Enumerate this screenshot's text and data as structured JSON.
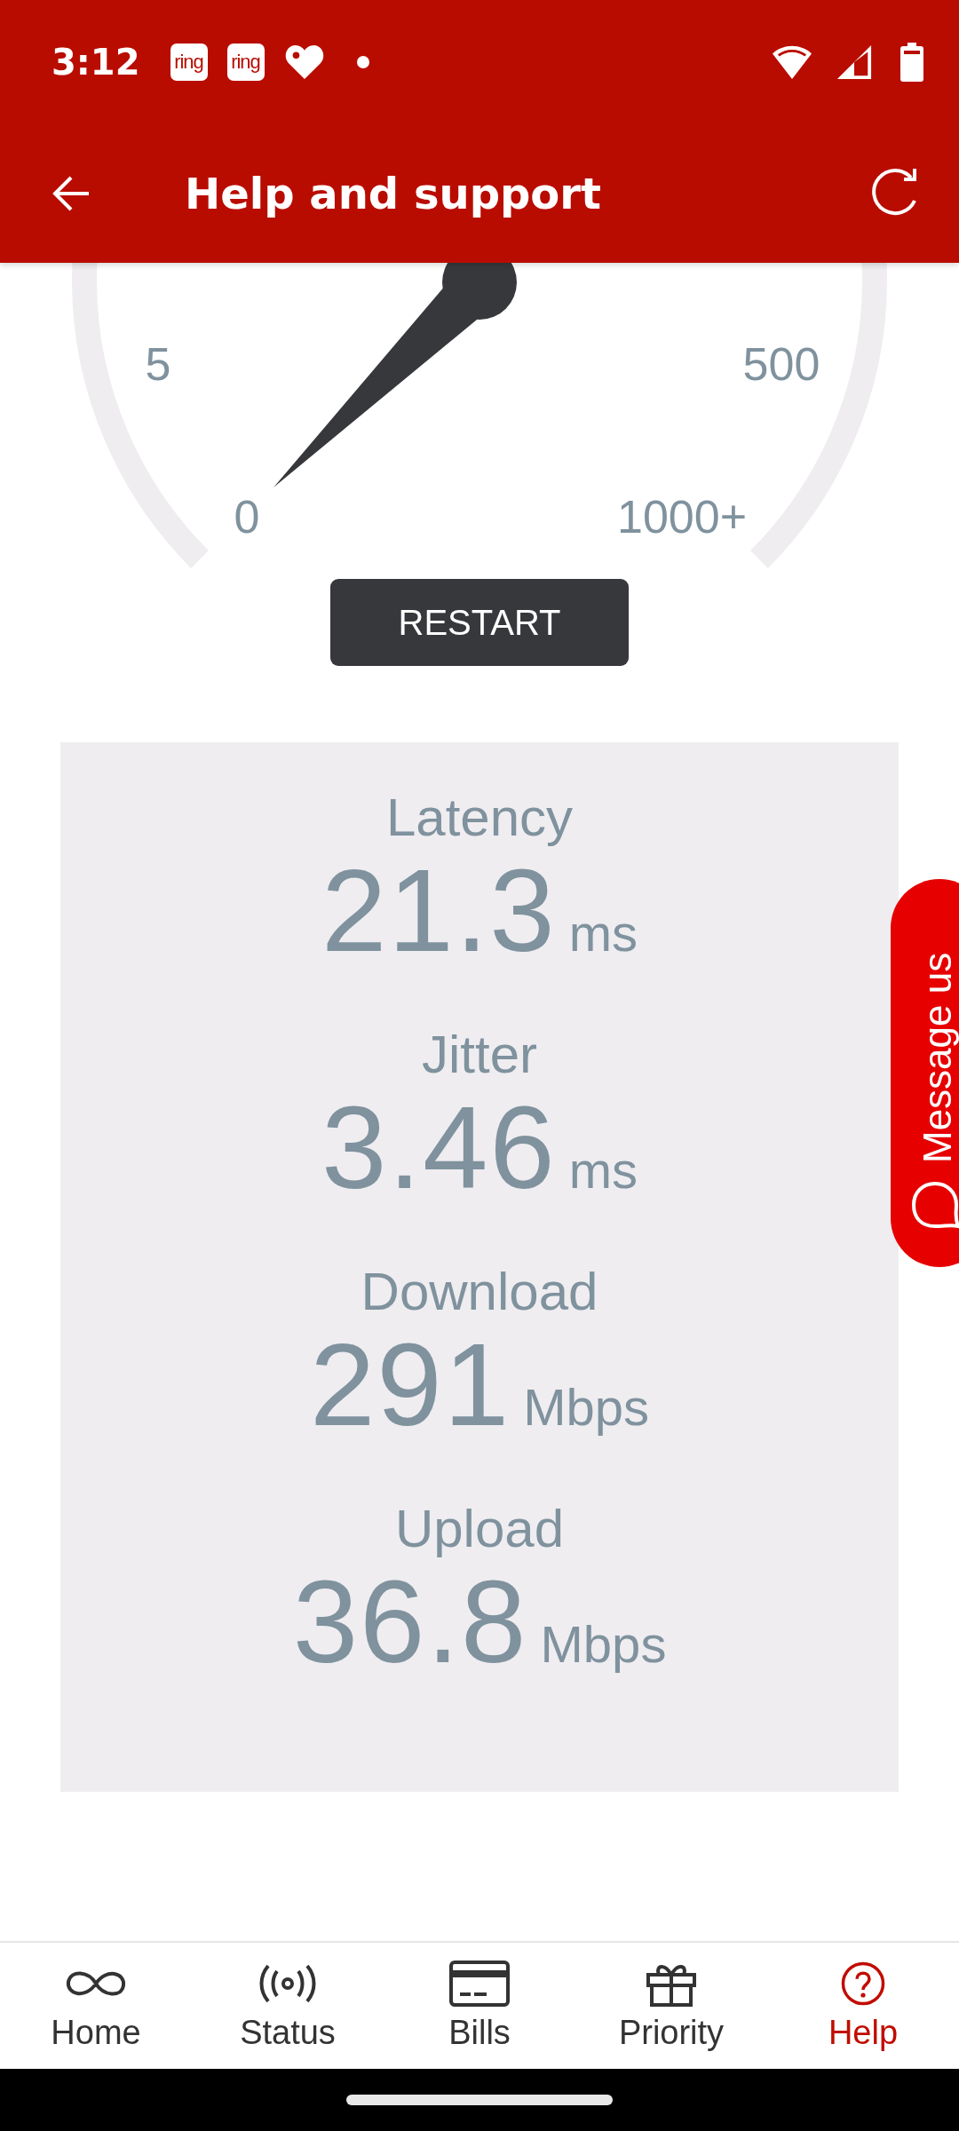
{
  "status_bar": {
    "time": "3:12",
    "notifications": [
      {
        "kind": "app",
        "label": "ring"
      },
      {
        "kind": "app",
        "label": "ring"
      },
      {
        "kind": "heart"
      },
      {
        "kind": "dot"
      }
    ]
  },
  "app_bar": {
    "title": "Help and support"
  },
  "gauge": {
    "labels": [
      "5",
      "500",
      "0",
      "1000+"
    ]
  },
  "restart_button": "RESTART",
  "results": [
    {
      "label": "Latency",
      "value": "21.3",
      "unit": "ms"
    },
    {
      "label": "Jitter",
      "value": "3.46",
      "unit": "ms"
    },
    {
      "label": "Download",
      "value": "291",
      "unit": "Mbps"
    },
    {
      "label": "Upload",
      "value": "36.8",
      "unit": "Mbps"
    }
  ],
  "message_tab": "Message us",
  "bottom_nav": [
    {
      "label": "Home",
      "kind": "infinity",
      "selected": false
    },
    {
      "label": "Status",
      "kind": "signal",
      "selected": false
    },
    {
      "label": "Bills",
      "kind": "card",
      "selected": false
    },
    {
      "label": "Priority",
      "kind": "gift",
      "selected": false
    },
    {
      "label": "Help",
      "kind": "help",
      "selected": true
    }
  ]
}
